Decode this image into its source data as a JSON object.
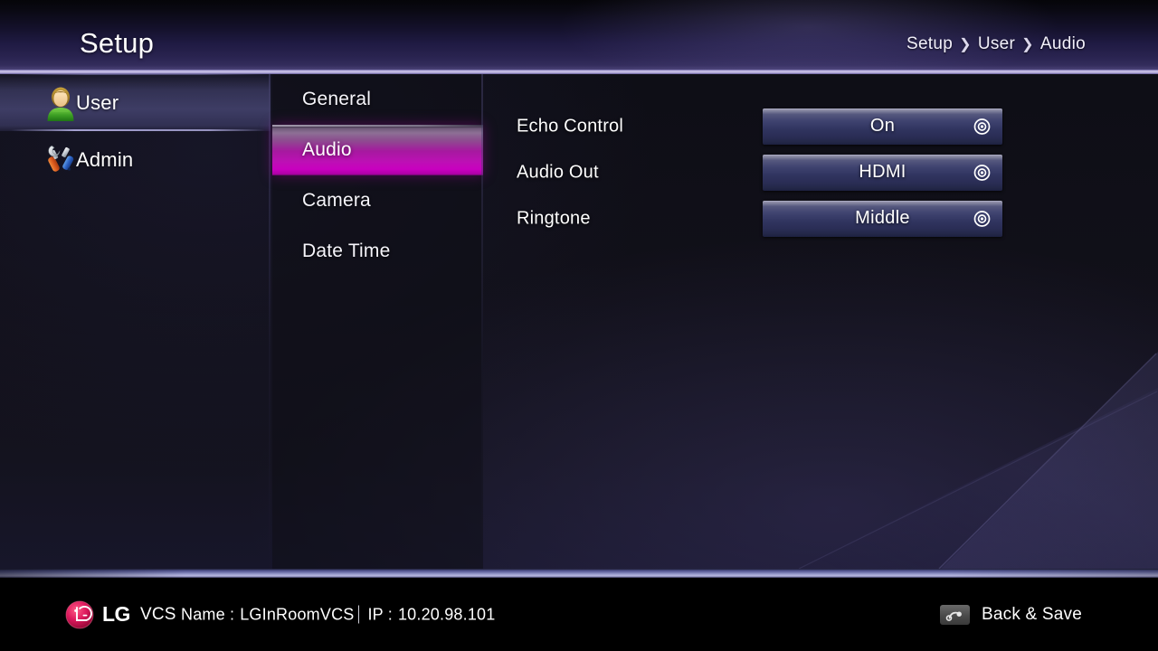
{
  "header": {
    "title": "Setup",
    "breadcrumb": [
      "Setup",
      "User",
      "Audio"
    ],
    "separator": "❯"
  },
  "sidebar": {
    "items": [
      {
        "label": "User",
        "icon": "user-icon",
        "active": true
      },
      {
        "label": "Admin",
        "icon": "tools-icon",
        "active": false
      }
    ]
  },
  "submenu": {
    "items": [
      {
        "label": "General",
        "active": false
      },
      {
        "label": "Audio",
        "active": true
      },
      {
        "label": "Camera",
        "active": false
      },
      {
        "label": "Date Time",
        "active": false
      }
    ]
  },
  "settings": {
    "rows": [
      {
        "label": "Echo Control",
        "value": "On",
        "icon": "target-icon"
      },
      {
        "label": "Audio Out",
        "value": "HDMI",
        "icon": "target-icon"
      },
      {
        "label": "Ringtone",
        "value": "Middle",
        "icon": "target-icon"
      }
    ]
  },
  "footer": {
    "brand": "LG",
    "product": "VCS",
    "name_label": "Name :",
    "name_value": "LGInRoomVCS",
    "ip_label": "IP :",
    "ip_value": "10.20.98.101",
    "back_save_label": "Back & Save",
    "back_icon": "back-arrow-icon"
  },
  "colors": {
    "header_accent": "#c8c0e8",
    "selected_submenu": "#c800bf",
    "footer_rule": "#b6b5dd",
    "lg_red": "#d4145a",
    "button_dark": "#2a2d55"
  }
}
